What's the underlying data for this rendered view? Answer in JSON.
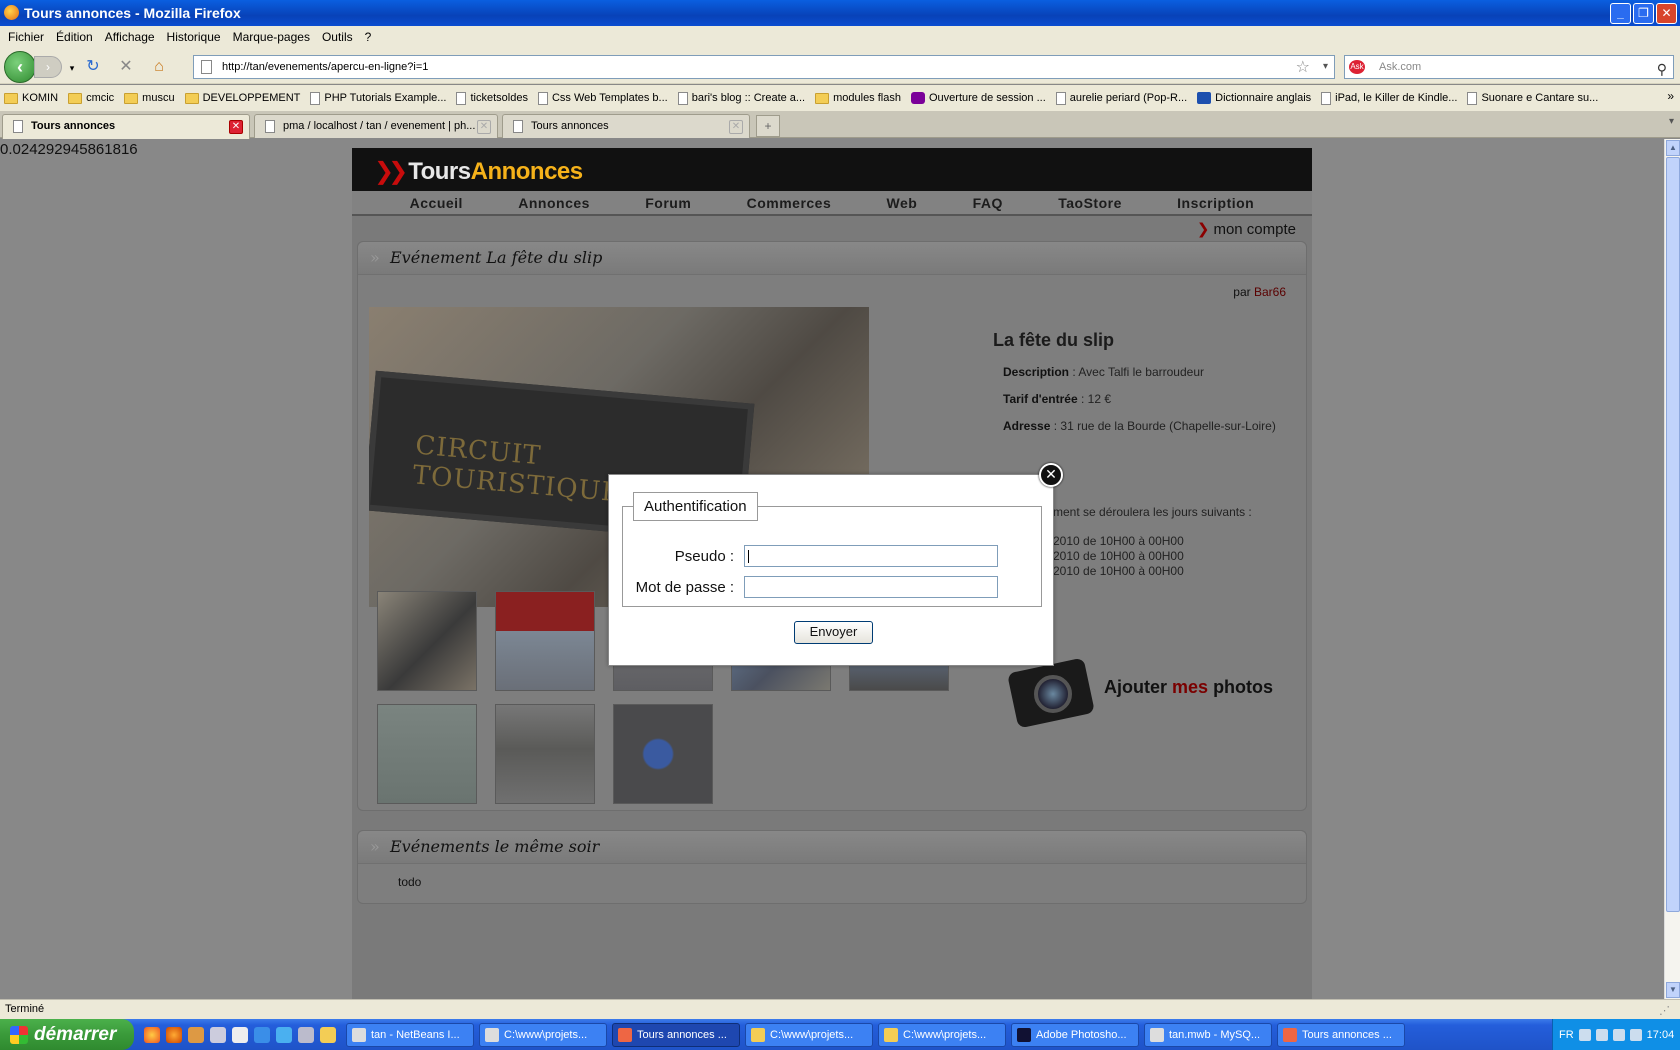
{
  "window": {
    "title": "Tours annonces - Mozilla Firefox"
  },
  "menu": [
    "Fichier",
    "Édition",
    "Affichage",
    "Historique",
    "Marque-pages",
    "Outils",
    "?"
  ],
  "url": "http://tan/evenements/apercu-en-ligne?i=1",
  "search": {
    "placeholder": "Ask.com"
  },
  "bookmarks": [
    {
      "label": "KOMIN",
      "icon": "folder-icon"
    },
    {
      "label": "cmcic",
      "icon": "folder-icon"
    },
    {
      "label": "muscu",
      "icon": "folder-icon"
    },
    {
      "label": "DEVELOPPEMENT",
      "icon": "folder-icon"
    },
    {
      "label": "PHP Tutorials Example...",
      "icon": "page-icon"
    },
    {
      "label": "ticketsoldes",
      "icon": "page-icon"
    },
    {
      "label": "Css Web Templates b...",
      "icon": "page-icon"
    },
    {
      "label": "bari's blog :: Create a...",
      "icon": "page-icon"
    },
    {
      "label": "modules flash",
      "icon": "folder-icon"
    },
    {
      "label": "Ouverture de session ...",
      "icon": "yahoo-icon"
    },
    {
      "label": "aurelie periard (Pop-R...",
      "icon": "page-icon"
    },
    {
      "label": "Dictionnaire anglais",
      "icon": "wordreference-icon"
    },
    {
      "label": "iPad, le Killer de Kindle...",
      "icon": "page-icon"
    },
    {
      "label": "Suonare e Cantare su...",
      "icon": "page-icon"
    }
  ],
  "tabs": [
    {
      "label": "Tours annonces",
      "active": true
    },
    {
      "label": "pma / localhost / tan / evenement | ph...",
      "active": false
    },
    {
      "label": "Tours annonces",
      "active": false
    }
  ],
  "debug_value": "0.024292945861816",
  "site": {
    "logo_a": "Tours",
    "logo_b": "Annonces",
    "nav": [
      "Accueil",
      "Annonces",
      "Forum",
      "Commerces",
      "Web",
      "FAQ",
      "TaoStore",
      "Inscription"
    ],
    "account": "mon compte",
    "event_panel_title": "Evénement La fête du slip",
    "by_prefix": "par",
    "by_user": "Bar66",
    "photo_text": "CIRCUIT TOURISTIQUE",
    "event": {
      "name": "La fête du slip",
      "description_label": "Description",
      "description": "Avec Talfi le barroudeur",
      "tarif_label": "Tarif d'entrée",
      "tarif": "12 €",
      "adresse_label": "Adresse",
      "adresse": "31 rue de la Bourde (Chapelle-sur-Loire)",
      "schedule_intro": "ment se déroulera les jours suivants :",
      "schedule": [
        "2010 de 10H00 à 00H00",
        "2010 de 10H00 à 00H00",
        "2010 de 10H00 à 00H00"
      ]
    },
    "add_photos_a": "Ajouter",
    "add_photos_b": "mes",
    "add_photos_c": "photos",
    "same_evening_title": "Evénements le même soir",
    "same_evening_body": "todo"
  },
  "modal": {
    "legend": "Authentification",
    "pseudo_label": "Pseudo :",
    "password_label": "Mot de passe :",
    "submit": "Envoyer"
  },
  "status": "Terminé",
  "taskbar": {
    "start": "démarrer",
    "items": [
      {
        "label": "tan - NetBeans I...",
        "active": false
      },
      {
        "label": "C:\\www\\projets...",
        "active": false
      },
      {
        "label": "Tours annonces ...",
        "active": true
      },
      {
        "label": "C:\\www\\projets...",
        "active": false
      },
      {
        "label": "C:\\www\\projets...",
        "active": false
      },
      {
        "label": "Adobe Photosho...",
        "active": false
      },
      {
        "label": "tan.mwb - MySQ...",
        "active": false
      },
      {
        "label": "Tours annonces ...",
        "active": false
      }
    ],
    "lang": "FR",
    "clock": "17:04"
  },
  "colors": {
    "accent": "#f6b21a",
    "brand_red": "#c80c0c",
    "overlay_gray": "#7a7a7a"
  }
}
